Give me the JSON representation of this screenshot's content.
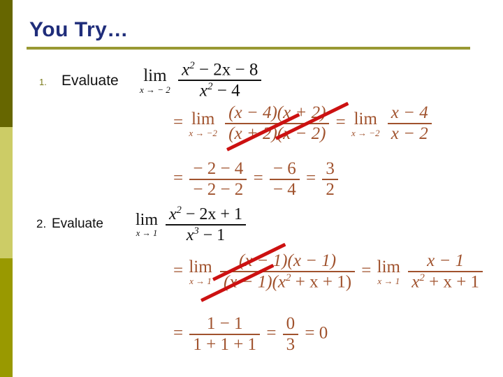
{
  "slide": {
    "title": "You Try…",
    "background_color": "#ffffff"
  },
  "theme": {
    "title_color": "#1F2D7A",
    "rule_color": "#999933",
    "math_color": "#A0522D",
    "statement_color": "#111111",
    "strike_color": "#CC1111",
    "bar_top_color": "#666600",
    "bar_mid_color": "#CCCC66",
    "bar_bottom_color": "#999900"
  },
  "sidebar": {
    "bars": [
      {
        "name": "bar-top",
        "color": "#666600"
      },
      {
        "name": "bar-mid",
        "color": "#CCCC66"
      },
      {
        "name": "bar-bottom",
        "color": "#999900"
      }
    ]
  },
  "problems": [
    {
      "number": "1.",
      "label": "Evaluate",
      "limit_var": "x",
      "limit_to": "− 2",
      "numerator": {
        "a": "x",
        "a_exp": "2",
        "rest": "− 2x − 8"
      },
      "denominator": {
        "a": "x",
        "a_exp": "2",
        "rest": "− 4"
      },
      "solution_line_1": {
        "eq": "=",
        "lim_sub": "x → −2",
        "frac_num": "(x − 4)(x + 2)",
        "frac_den": "(x + 2)(x − 2)",
        "eq2": "=",
        "lim_sub2": "x → −2",
        "frac_num2": "x − 4",
        "frac_den2": "x − 2"
      },
      "solution_line_2": {
        "eq": "=",
        "frac_num": "− 2 − 4",
        "frac_den": "− 2 − 2",
        "eq2": "=",
        "frac_num2": "− 6",
        "frac_den2": "− 4",
        "eq3": "=",
        "frac_num3": "3",
        "frac_den3": "2"
      }
    },
    {
      "number": "2.",
      "label": "Evaluate",
      "limit_var": "x",
      "limit_to": "1",
      "numerator": {
        "a": "x",
        "a_exp": "2",
        "rest": "− 2x + 1"
      },
      "denominator": {
        "a": "x",
        "a_exp": "3",
        "rest": "− 1"
      },
      "solution_line_1": {
        "eq": "=",
        "lim_sub": "x → 1",
        "frac_num": "(x − 1)(x − 1)",
        "frac_den_open": "(x − 1)(x",
        "frac_den_exp": "2",
        "frac_den_rest": "+ x + 1)",
        "eq2": "=",
        "lim_sub2": "x → 1",
        "frac_num2": "x − 1",
        "frac_den2_open": "x",
        "frac_den2_exp": "2",
        "frac_den2_rest": "+ x + 1"
      },
      "solution_line_2": {
        "eq": "=",
        "frac_num": "1 − 1",
        "frac_den": "1 + 1 + 1",
        "eq2": "=",
        "frac_num2": "0",
        "frac_den2": "3",
        "eq3": "= 0"
      }
    }
  ],
  "annotations": {
    "strikes": [
      {
        "name": "cancel-x-plus-2-numerator"
      },
      {
        "name": "cancel-x-plus-2-denominator"
      },
      {
        "name": "cancel-x-minus-1-numerator"
      },
      {
        "name": "cancel-x-minus-1-denominator"
      }
    ]
  },
  "lim_word": "lim"
}
